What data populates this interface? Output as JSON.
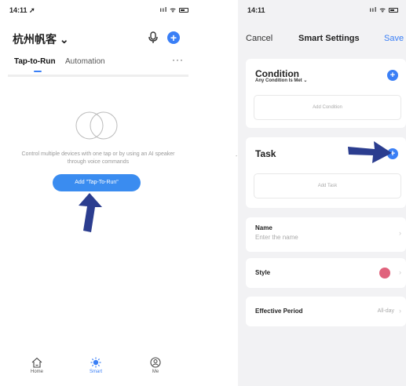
{
  "left": {
    "status": {
      "time": "14:11 ➚",
      "icons": "ııl ᯤ"
    },
    "home_title": "杭州帆客 ⌄",
    "add_icon": "+",
    "tabs": [
      {
        "label": "Tap-to-Run"
      },
      {
        "label": "Automation"
      }
    ],
    "more": "···",
    "hint": "Control multiple devices with one tap or by using an AI speaker through voice commands",
    "add_button": "Add \"Tap-To-Run\"",
    "nav": [
      {
        "label": "Home",
        "icon": "home-icon"
      },
      {
        "label": "Smart",
        "icon": "smart-sun-icon"
      },
      {
        "label": "Me",
        "icon": "me-icon"
      }
    ],
    "accent": "#3a7ff6",
    "arrow_color": "#2b3d8f"
  },
  "right": {
    "status": {
      "time": "14:11",
      "icons": "ııl ᯤ"
    },
    "header": {
      "cancel": "Cancel",
      "title": "Smart Settings",
      "save": "Save"
    },
    "condition": {
      "title": "Condition",
      "subtitle": "Any Condition Is Met ⌄",
      "add_label": "Add Condition"
    },
    "task": {
      "title": "Task",
      "add_label": "Add Task"
    },
    "name": {
      "label": "Name",
      "placeholder": "Enter the name"
    },
    "style": {
      "label": "Style",
      "color": "#e0627c"
    },
    "period": {
      "label": "Effective Period",
      "value": "All-day"
    },
    "plus": "+",
    "chevron": "›",
    "dash": "-"
  }
}
